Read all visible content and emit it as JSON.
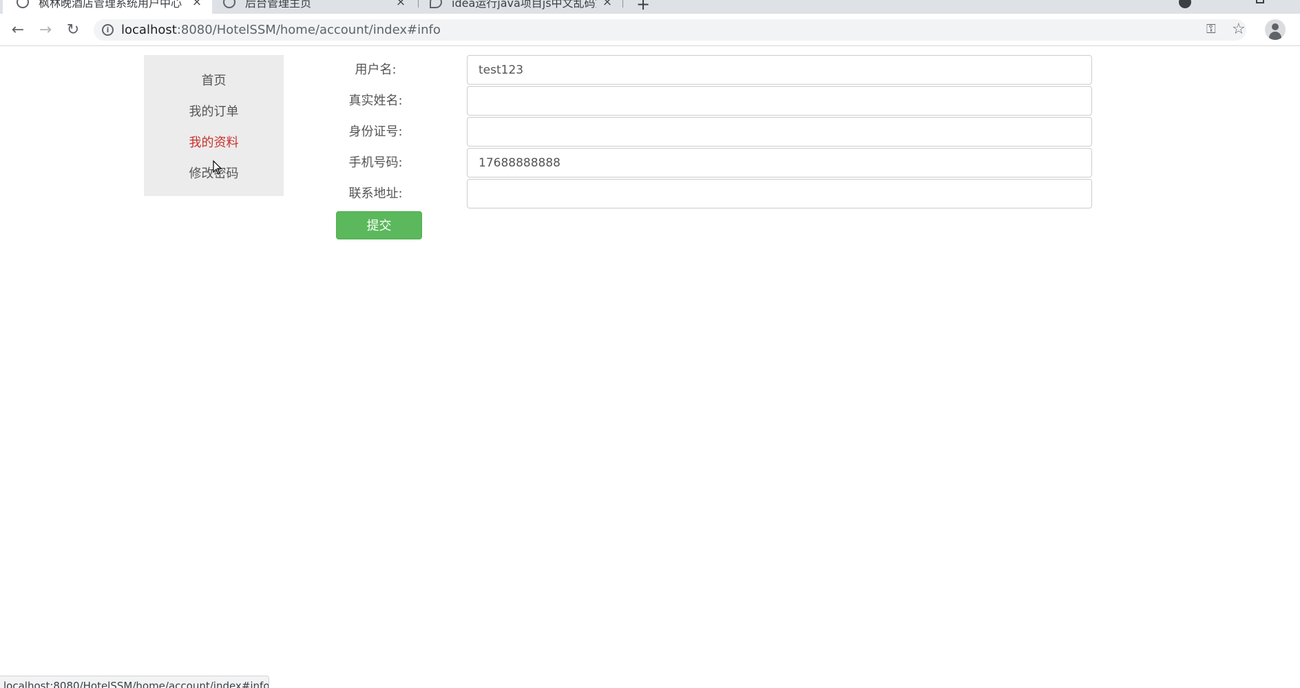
{
  "browser": {
    "tabs": [
      {
        "title": "枫林晚酒店管理系统用户中心",
        "close": "×",
        "active": true
      },
      {
        "title": "后台管理主页",
        "close": "×",
        "active": false
      },
      {
        "title": "idea运行java项目js中文乱码如何",
        "close": "×",
        "active": false
      }
    ],
    "new_tab": "+",
    "url_host": "localhost",
    "url_path": ":8080/HotelSSM/home/account/index#info",
    "status_url": "localhost:8080/HotelSSM/home/account/index#info"
  },
  "sidebar": {
    "items": [
      {
        "label": "首页"
      },
      {
        "label": "我的订单"
      },
      {
        "label": "我的资料"
      },
      {
        "label": "修改密码"
      }
    ],
    "active_index": 2
  },
  "form": {
    "username_label": "用户名:",
    "username_value": "test123",
    "realname_label": "真实姓名:",
    "realname_value": "",
    "idcard_label": "身份证号:",
    "idcard_value": "",
    "phone_label": "手机号码:",
    "phone_value": "17688888888",
    "address_label": "联系地址:",
    "address_value": "",
    "submit_label": "提交"
  },
  "colors": {
    "active_link": "#c9302c",
    "submit_button": "#5cb85c",
    "sidebar_bg": "#ececec"
  }
}
